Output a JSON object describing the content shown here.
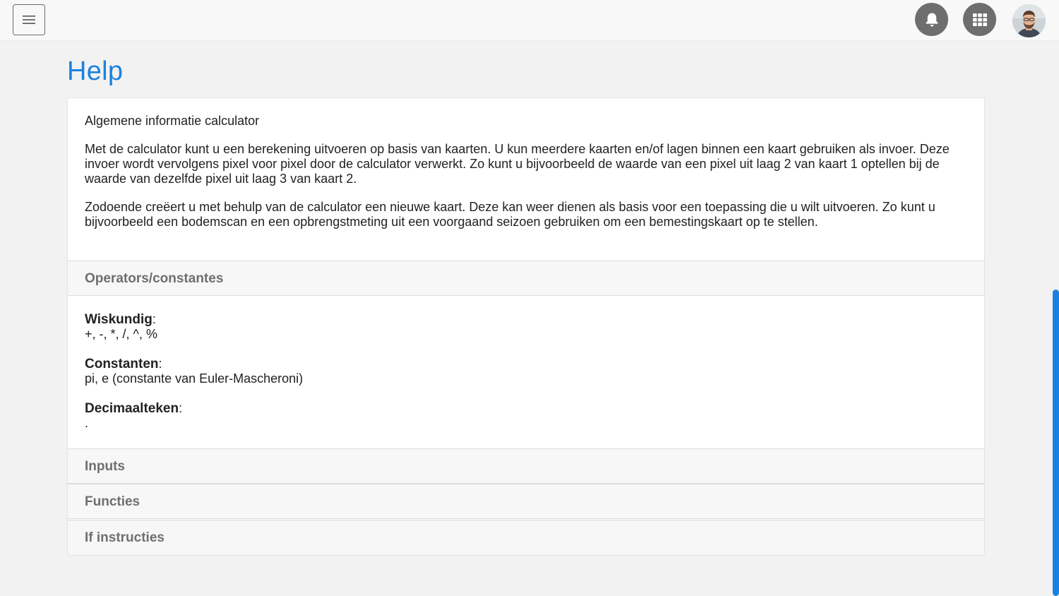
{
  "header": {
    "menu_icon": "hamburger-icon",
    "notifications_icon": "bell-icon",
    "apps_icon": "grid-icon",
    "avatar_icon": "user-avatar",
    "button_color": "#6e6e6e"
  },
  "page": {
    "title": "Help",
    "title_color": "#1a82e2"
  },
  "intro": {
    "heading": "Algemene informatie calculator",
    "paragraph1": "Met de calculator kunt u een berekening uitvoeren op basis van kaarten. U kun meerdere kaarten en/of lagen binnen een kaart gebruiken als invoer. Deze invoer wordt vervolgens pixel voor pixel door de calculator verwerkt. Zo kunt u bijvoorbeeld de waarde van een pixel uit laag 2 van kaart 1 optellen bij de waarde van dezelfde pixel uit laag 3 van kaart 2.",
    "paragraph2": "Zodoende creëert u met behulp van de calculator een nieuwe kaart. Deze kan weer dienen als basis voor een toepassing die u wilt uitvoeren. Zo kunt u bijvoorbeeld een bodemscan en een opbrengstmeting uit een voorgaand seizoen gebruiken om een bemestingskaart op te stellen."
  },
  "accordion": {
    "operators": {
      "title": "Operators/constantes",
      "expanded": true,
      "math_label": "Wiskundig",
      "math_value": "+, -, *, /, ^, %",
      "constants_label": "Constanten",
      "constants_value": "pi, e (constante van Euler-Mascheroni)",
      "decimal_label": "Decimaalteken",
      "decimal_value": "."
    },
    "inputs": {
      "title": "Inputs"
    },
    "functions": {
      "title": "Functies"
    },
    "if_instructions": {
      "title": "If instructies"
    }
  },
  "scrollbar": {
    "color": "#1a82e2"
  }
}
